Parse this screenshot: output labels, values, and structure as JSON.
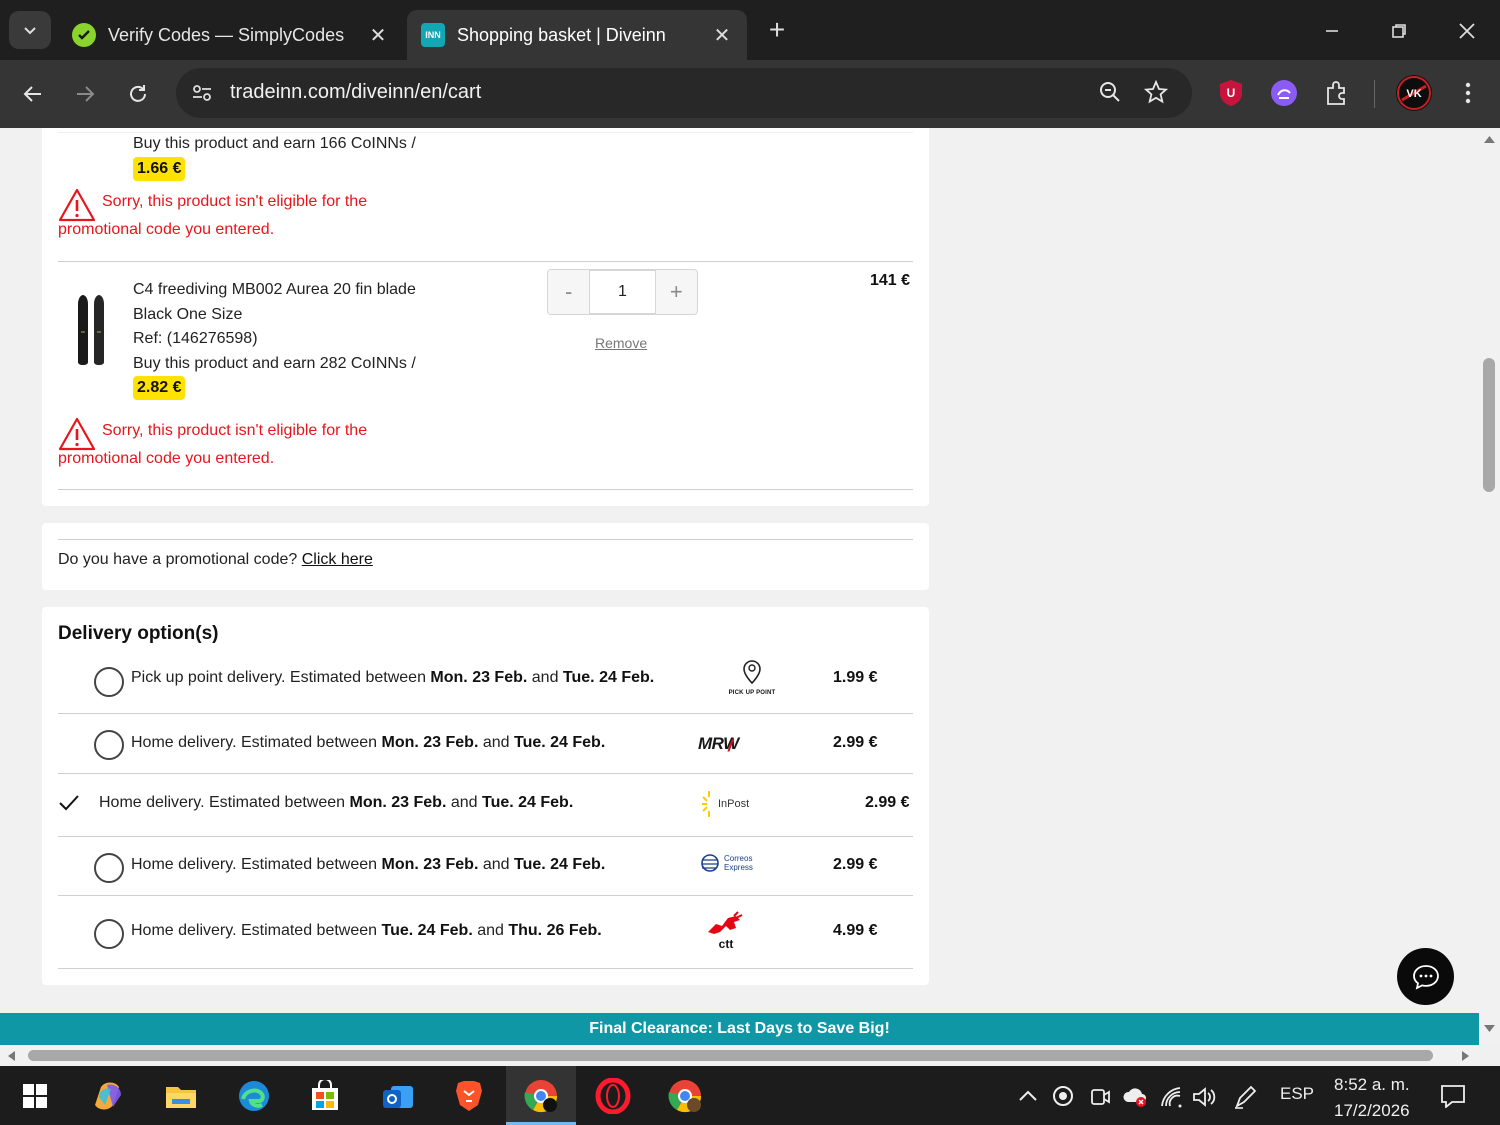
{
  "browser": {
    "tabs": [
      {
        "title": "Verify Codes — SimplyCodes",
        "active": false,
        "favicon": "simplycodes-check-icon"
      },
      {
        "title": "Shopping basket | Diveinn",
        "active": true,
        "favicon": "inn-logo-icon",
        "favicon_text": "INN"
      }
    ],
    "url": "tradeinn.com/diveinn/en/cart",
    "extension_badge": "VK"
  },
  "cart": {
    "previous_item": {
      "coins_text": "Buy this product and earn 166 CoINNs /",
      "coins_value": "1.66 €",
      "warning_line1": "Sorry, this product isn't eligible for the",
      "warning_line2": "promotional code you entered."
    },
    "item": {
      "name": "C4 freediving MB002 Aurea 20 fin blade",
      "variant": "Black One Size",
      "ref": "Ref: (146276598)",
      "coins_text": "Buy this product and earn 282 CoINNs /",
      "coins_value": "2.82 €",
      "quantity": "1",
      "qty_minus": "-",
      "qty_plus": "+",
      "remove_label": "Remove",
      "price": "141 €",
      "warning_line1": "Sorry, this product isn't eligible for the",
      "warning_line2": "promotional code you entered."
    }
  },
  "promo": {
    "question": "Do you have a promotional code?",
    "link": "Click here"
  },
  "delivery": {
    "title": "Delivery option(s)",
    "options": [
      {
        "text": "Pick up point delivery. Estimated between ",
        "date1": "Mon. 23 Feb.",
        "and": " and ",
        "date2": "Tue. 24 Feb.",
        "carrier": "PICK UP POINT",
        "price": "1.99 €",
        "selected": false
      },
      {
        "text": "Home delivery. Estimated between ",
        "date1": "Mon. 23 Feb.",
        "and": " and ",
        "date2": "Tue. 24 Feb.",
        "carrier": "MRW",
        "price": "2.99 €",
        "selected": false
      },
      {
        "text": "Home delivery. Estimated between ",
        "date1": "Mon. 23 Feb.",
        "and": " and ",
        "date2": "Tue. 24 Feb.",
        "carrier": "InPost",
        "price": "2.99 €",
        "selected": true
      },
      {
        "text": "Home delivery. Estimated between ",
        "date1": "Mon. 23 Feb.",
        "and": " and ",
        "date2": "Tue. 24 Feb.",
        "carrier": "Correos Express",
        "carrier_line1": "Correos",
        "carrier_line2": "Express",
        "price": "2.99 €",
        "selected": false
      },
      {
        "text": "Home delivery. Estimated between ",
        "date1": "Tue. 24 Feb.",
        "and": " and ",
        "date2": "Thu. 26 Feb.",
        "carrier": "ctt",
        "price": "4.99 €",
        "selected": false
      }
    ]
  },
  "banner": {
    "text": "Final Clearance: Last Days to Save Big!"
  },
  "taskbar": {
    "language": "ESP",
    "time": "8:52 a. m.",
    "date": "17/2/2026"
  },
  "colors": {
    "warning": "#e8151b",
    "coins_pill": "#ffe200",
    "banner": "#0f97a5"
  }
}
